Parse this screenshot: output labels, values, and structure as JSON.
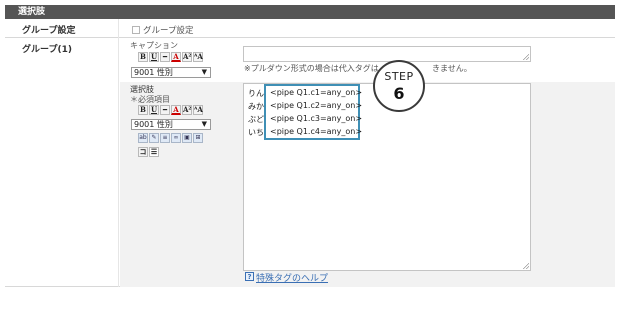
{
  "header": {
    "title": "選択肢"
  },
  "group_setting": {
    "label": "グループ設定",
    "checkbox_label": "グループ設定"
  },
  "group1": {
    "label": "グループ(1)",
    "caption_label": "キャプション",
    "caption_toolbar": [
      "B",
      "U",
      "━",
      "A",
      "A²",
      "ᴬA"
    ],
    "caption_format_select": "9001 性別",
    "pulldown_note": "※プルダウン形式の場合は代入タグは",
    "pulldown_note_tail": "きません。",
    "choices_label": "選択肢",
    "required_label": "＊必須項目",
    "choices_toolbar": [
      "B",
      "U",
      "━",
      "A",
      "A²",
      "ᴬA"
    ],
    "choices_format_select": "9001 性別",
    "extra_icons": [
      "ab",
      "paint",
      "list",
      "link",
      "img",
      "table"
    ],
    "extra_icons2": [
      "コ",
      "list2"
    ],
    "choice_prefixes": [
      "りん",
      "みか",
      "ぶど",
      "いち"
    ],
    "choice_tags": [
      "<pipe Q1.c1=any_on>",
      "<pipe Q1.c2=any_on>",
      "<pipe Q1.c3=any_on>",
      "<pipe Q1.c4=any_on>"
    ],
    "help_icon": "?",
    "help_link": "特殊タグのヘルプ"
  },
  "step_badge": {
    "label": "STEP",
    "number": "6"
  },
  "colors": {
    "header_bg": "#555555",
    "highlight_border": "#3f8fb5",
    "link": "#3a6fb4"
  }
}
